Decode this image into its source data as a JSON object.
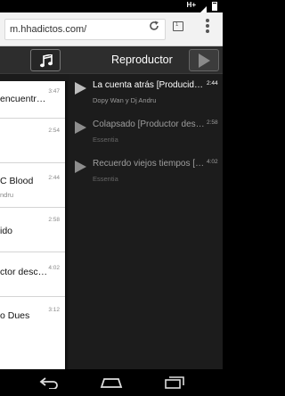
{
  "status_bar": {
    "network": "H+"
  },
  "browser": {
    "url": "m.hhadictos.com/",
    "tabs_count": "1"
  },
  "player": {
    "title": "Reproductor",
    "queue": [
      {
        "title": "La cuenta atrás [Producido por Dj Andru]",
        "duration": "2:44",
        "artist": "Dopy Wan y Dj Andru",
        "state": "active"
      },
      {
        "title": "Colapsado [Productor desconocido]",
        "duration": "2:58",
        "artist": "Essentia",
        "state": "dim"
      },
      {
        "title": "Recuerdo viejos tiempos [Productor desconocido]",
        "duration": "4:02",
        "artist": "Essentia",
        "state": "dim"
      }
    ]
  },
  "left_list": {
    "rows": [
      {
        "title": "encuentr…",
        "duration": "3:47",
        "subtitle": ""
      },
      {
        "title": "",
        "duration": "2:54",
        "subtitle": ""
      },
      {
        "title": "C Blood",
        "duration": "2:44",
        "subtitle": "ndru"
      },
      {
        "title": "ido",
        "duration": "2:58",
        "subtitle": ""
      },
      {
        "title": "ctor desc…",
        "duration": "4:02",
        "subtitle": ""
      },
      {
        "title": "o Dues",
        "duration": "3:12",
        "subtitle": ""
      }
    ]
  },
  "colors": {
    "accent_text": "#ffffff",
    "page_background": "#1b1b1b",
    "header_background": "#2d2d2d",
    "list_background": "#ffffff"
  }
}
